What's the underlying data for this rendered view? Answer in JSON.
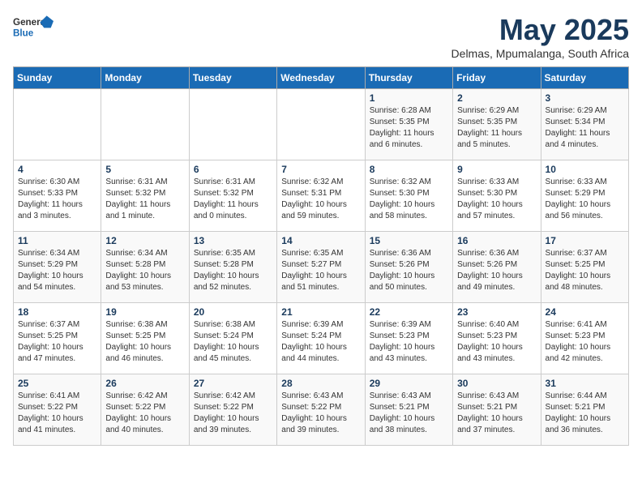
{
  "header": {
    "logo_general": "General",
    "logo_blue": "Blue",
    "title": "May 2025",
    "subtitle": "Delmas, Mpumalanga, South Africa"
  },
  "weekdays": [
    "Sunday",
    "Monday",
    "Tuesday",
    "Wednesday",
    "Thursday",
    "Friday",
    "Saturday"
  ],
  "weeks": [
    [
      {
        "day": "",
        "sunrise": "",
        "sunset": "",
        "daylight": ""
      },
      {
        "day": "",
        "sunrise": "",
        "sunset": "",
        "daylight": ""
      },
      {
        "day": "",
        "sunrise": "",
        "sunset": "",
        "daylight": ""
      },
      {
        "day": "",
        "sunrise": "",
        "sunset": "",
        "daylight": ""
      },
      {
        "day": "1",
        "sunrise": "Sunrise: 6:28 AM",
        "sunset": "Sunset: 5:35 PM",
        "daylight": "Daylight: 11 hours and 6 minutes."
      },
      {
        "day": "2",
        "sunrise": "Sunrise: 6:29 AM",
        "sunset": "Sunset: 5:35 PM",
        "daylight": "Daylight: 11 hours and 5 minutes."
      },
      {
        "day": "3",
        "sunrise": "Sunrise: 6:29 AM",
        "sunset": "Sunset: 5:34 PM",
        "daylight": "Daylight: 11 hours and 4 minutes."
      }
    ],
    [
      {
        "day": "4",
        "sunrise": "Sunrise: 6:30 AM",
        "sunset": "Sunset: 5:33 PM",
        "daylight": "Daylight: 11 hours and 3 minutes."
      },
      {
        "day": "5",
        "sunrise": "Sunrise: 6:31 AM",
        "sunset": "Sunset: 5:32 PM",
        "daylight": "Daylight: 11 hours and 1 minute."
      },
      {
        "day": "6",
        "sunrise": "Sunrise: 6:31 AM",
        "sunset": "Sunset: 5:32 PM",
        "daylight": "Daylight: 11 hours and 0 minutes."
      },
      {
        "day": "7",
        "sunrise": "Sunrise: 6:32 AM",
        "sunset": "Sunset: 5:31 PM",
        "daylight": "Daylight: 10 hours and 59 minutes."
      },
      {
        "day": "8",
        "sunrise": "Sunrise: 6:32 AM",
        "sunset": "Sunset: 5:30 PM",
        "daylight": "Daylight: 10 hours and 58 minutes."
      },
      {
        "day": "9",
        "sunrise": "Sunrise: 6:33 AM",
        "sunset": "Sunset: 5:30 PM",
        "daylight": "Daylight: 10 hours and 57 minutes."
      },
      {
        "day": "10",
        "sunrise": "Sunrise: 6:33 AM",
        "sunset": "Sunset: 5:29 PM",
        "daylight": "Daylight: 10 hours and 56 minutes."
      }
    ],
    [
      {
        "day": "11",
        "sunrise": "Sunrise: 6:34 AM",
        "sunset": "Sunset: 5:29 PM",
        "daylight": "Daylight: 10 hours and 54 minutes."
      },
      {
        "day": "12",
        "sunrise": "Sunrise: 6:34 AM",
        "sunset": "Sunset: 5:28 PM",
        "daylight": "Daylight: 10 hours and 53 minutes."
      },
      {
        "day": "13",
        "sunrise": "Sunrise: 6:35 AM",
        "sunset": "Sunset: 5:28 PM",
        "daylight": "Daylight: 10 hours and 52 minutes."
      },
      {
        "day": "14",
        "sunrise": "Sunrise: 6:35 AM",
        "sunset": "Sunset: 5:27 PM",
        "daylight": "Daylight: 10 hours and 51 minutes."
      },
      {
        "day": "15",
        "sunrise": "Sunrise: 6:36 AM",
        "sunset": "Sunset: 5:26 PM",
        "daylight": "Daylight: 10 hours and 50 minutes."
      },
      {
        "day": "16",
        "sunrise": "Sunrise: 6:36 AM",
        "sunset": "Sunset: 5:26 PM",
        "daylight": "Daylight: 10 hours and 49 minutes."
      },
      {
        "day": "17",
        "sunrise": "Sunrise: 6:37 AM",
        "sunset": "Sunset: 5:25 PM",
        "daylight": "Daylight: 10 hours and 48 minutes."
      }
    ],
    [
      {
        "day": "18",
        "sunrise": "Sunrise: 6:37 AM",
        "sunset": "Sunset: 5:25 PM",
        "daylight": "Daylight: 10 hours and 47 minutes."
      },
      {
        "day": "19",
        "sunrise": "Sunrise: 6:38 AM",
        "sunset": "Sunset: 5:25 PM",
        "daylight": "Daylight: 10 hours and 46 minutes."
      },
      {
        "day": "20",
        "sunrise": "Sunrise: 6:38 AM",
        "sunset": "Sunset: 5:24 PM",
        "daylight": "Daylight: 10 hours and 45 minutes."
      },
      {
        "day": "21",
        "sunrise": "Sunrise: 6:39 AM",
        "sunset": "Sunset: 5:24 PM",
        "daylight": "Daylight: 10 hours and 44 minutes."
      },
      {
        "day": "22",
        "sunrise": "Sunrise: 6:39 AM",
        "sunset": "Sunset: 5:23 PM",
        "daylight": "Daylight: 10 hours and 43 minutes."
      },
      {
        "day": "23",
        "sunrise": "Sunrise: 6:40 AM",
        "sunset": "Sunset: 5:23 PM",
        "daylight": "Daylight: 10 hours and 43 minutes."
      },
      {
        "day": "24",
        "sunrise": "Sunrise: 6:41 AM",
        "sunset": "Sunset: 5:23 PM",
        "daylight": "Daylight: 10 hours and 42 minutes."
      }
    ],
    [
      {
        "day": "25",
        "sunrise": "Sunrise: 6:41 AM",
        "sunset": "Sunset: 5:22 PM",
        "daylight": "Daylight: 10 hours and 41 minutes."
      },
      {
        "day": "26",
        "sunrise": "Sunrise: 6:42 AM",
        "sunset": "Sunset: 5:22 PM",
        "daylight": "Daylight: 10 hours and 40 minutes."
      },
      {
        "day": "27",
        "sunrise": "Sunrise: 6:42 AM",
        "sunset": "Sunset: 5:22 PM",
        "daylight": "Daylight: 10 hours and 39 minutes."
      },
      {
        "day": "28",
        "sunrise": "Sunrise: 6:43 AM",
        "sunset": "Sunset: 5:22 PM",
        "daylight": "Daylight: 10 hours and 39 minutes."
      },
      {
        "day": "29",
        "sunrise": "Sunrise: 6:43 AM",
        "sunset": "Sunset: 5:21 PM",
        "daylight": "Daylight: 10 hours and 38 minutes."
      },
      {
        "day": "30",
        "sunrise": "Sunrise: 6:43 AM",
        "sunset": "Sunset: 5:21 PM",
        "daylight": "Daylight: 10 hours and 37 minutes."
      },
      {
        "day": "31",
        "sunrise": "Sunrise: 6:44 AM",
        "sunset": "Sunset: 5:21 PM",
        "daylight": "Daylight: 10 hours and 36 minutes."
      }
    ]
  ]
}
